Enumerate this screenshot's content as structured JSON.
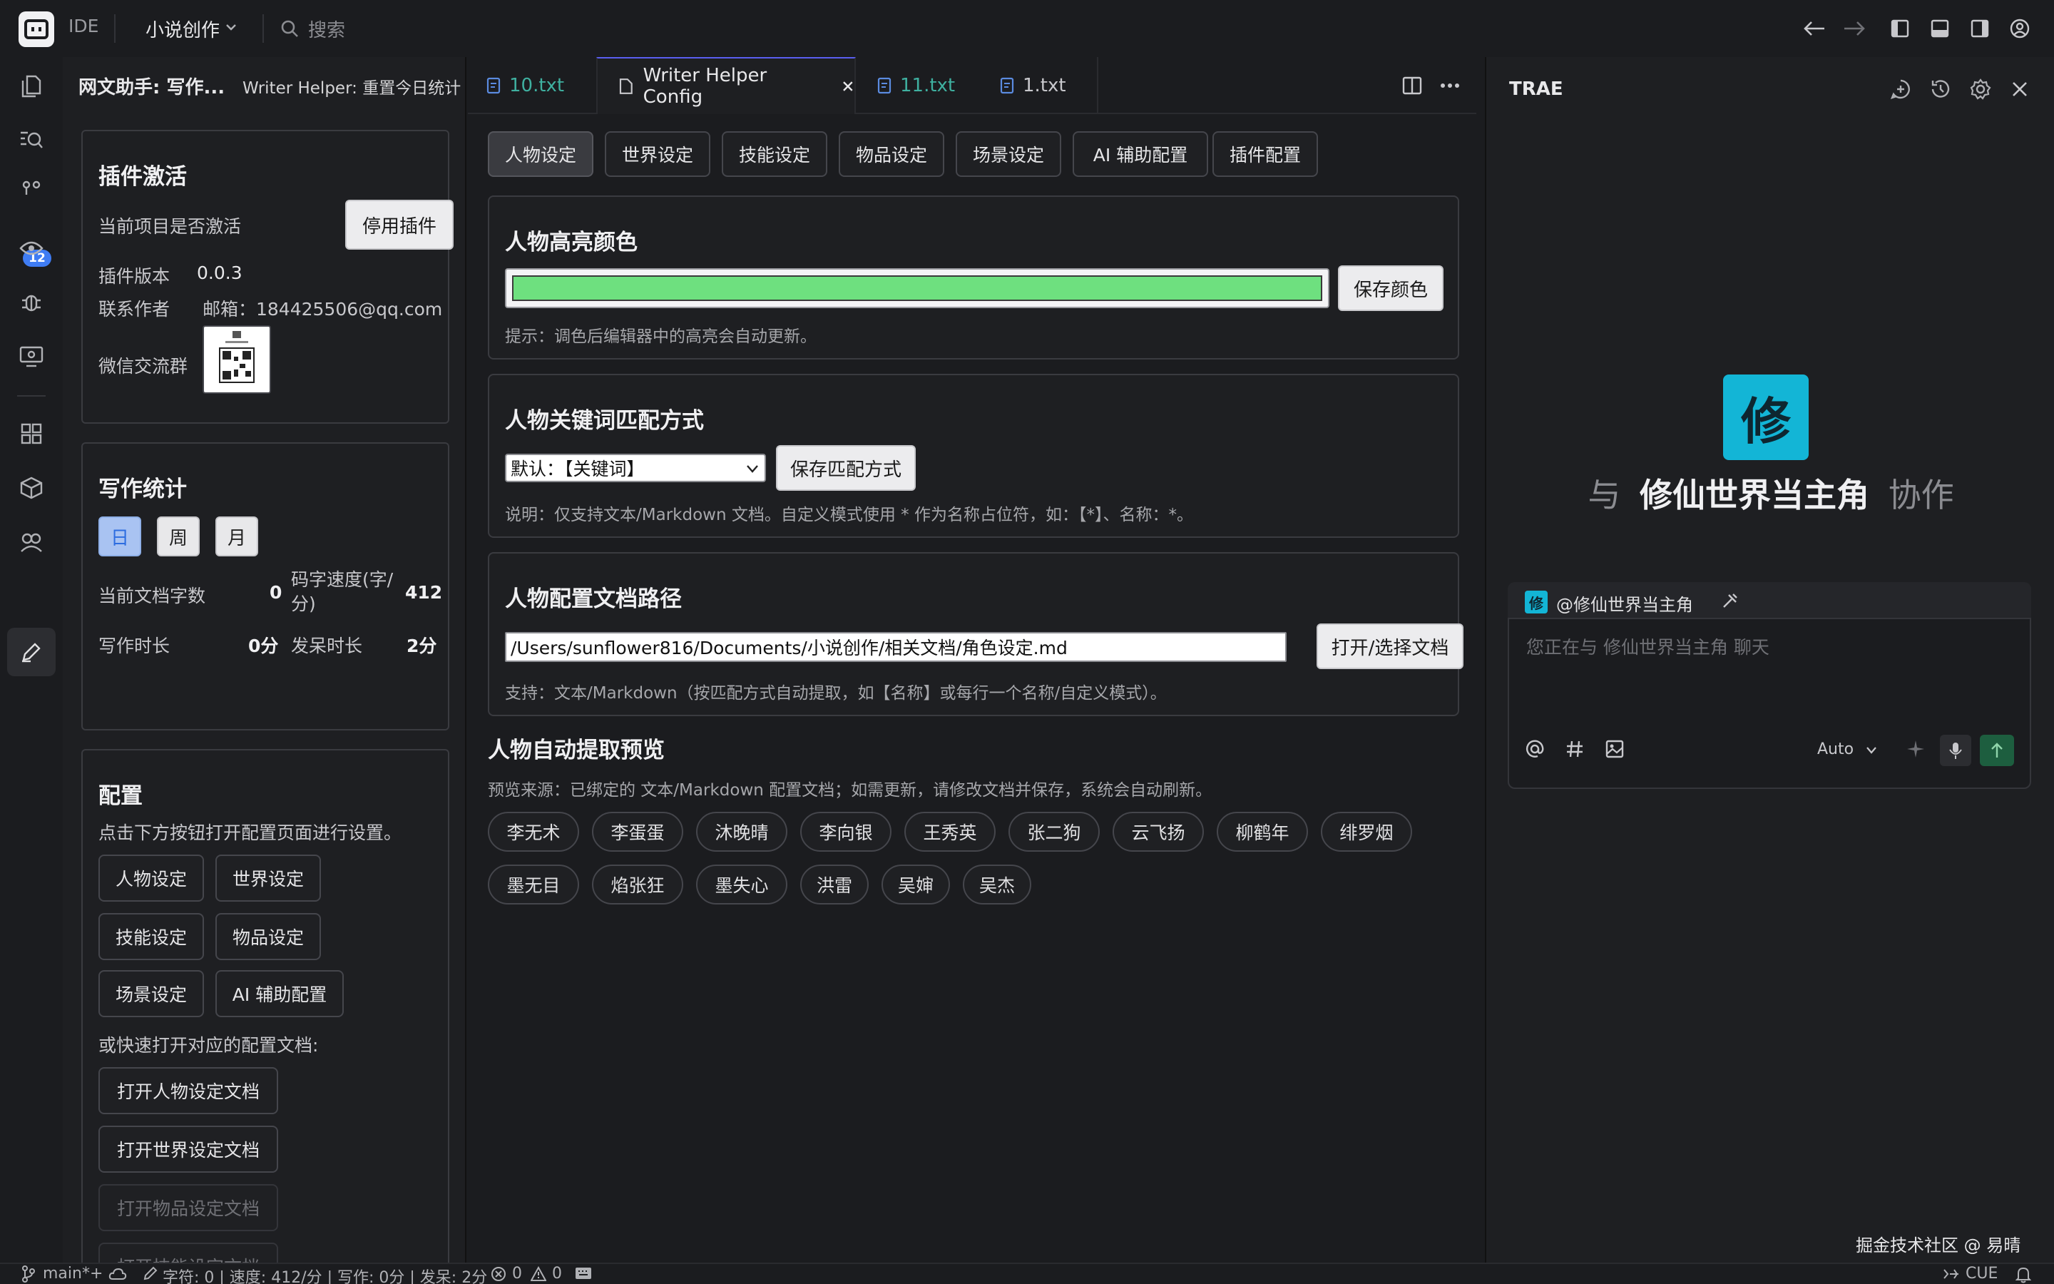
{
  "titlebar": {
    "ide_label": "IDE",
    "project": "小说创作",
    "search_placeholder": "搜索"
  },
  "activity": {
    "scm_badge": "12"
  },
  "left_panel": {
    "title": "网文助手: 写作...",
    "action": "Writer Helper: 重置今日统计",
    "activation": {
      "heading": "插件激活",
      "status_label": "当前项目是否激活",
      "disable_button": "停用插件",
      "version_label": "插件版本",
      "version_value": "0.0.3",
      "author_label": "联系作者",
      "author_value": "邮箱：184425506@qq.com",
      "wechat_label": "微信交流群"
    },
    "stats": {
      "heading": "写作统计",
      "periods": [
        "日",
        "周",
        "月"
      ],
      "chars_label": "当前文档字数",
      "chars_value": "0",
      "speed_label": "码字速度(字/分)",
      "speed_value": "412",
      "duration_label": "写作时长",
      "duration_value": "0分",
      "idle_label": "发呆时长",
      "idle_value": "2分"
    },
    "config": {
      "heading": "配置",
      "desc": "点击下方按钮打开配置页面进行设置。",
      "buttons": [
        "人物设定",
        "世界设定",
        "技能设定",
        "物品设定",
        "场景设定",
        "AI 辅助配置"
      ],
      "quick_label": "或快速打开对应的配置文档:",
      "open_buttons": [
        "打开人物设定文档",
        "打开世界设定文档",
        "打开物品设定文档",
        "打开技能设定文档"
      ]
    }
  },
  "editor": {
    "tabs": [
      {
        "label": "10.txt",
        "color": "#3fb0a0"
      },
      {
        "label": "Writer Helper Config",
        "color": "#e8e8ea"
      },
      {
        "label": "11.txt",
        "color": "#3fb0a0"
      },
      {
        "label": "1.txt",
        "color": "#c8c8cc"
      }
    ],
    "config_tabs": [
      "人物设定",
      "世界设定",
      "技能设定",
      "物品设定",
      "场景设定",
      "AI 辅助配置",
      "插件配置"
    ],
    "highlight": {
      "heading": "人物高亮颜色",
      "color": "#6ee07f",
      "save_button": "保存颜色",
      "hint": "提示：调色后编辑器中的高亮会自动更新。"
    },
    "match": {
      "heading": "人物关键词匹配方式",
      "selected": "默认：【关键词】",
      "save_button": "保存匹配方式",
      "hint": "说明：仅支持文本/Markdown 文档。自定义模式使用 * 作为名称占位符，如：【*】、名称：*。"
    },
    "path": {
      "heading": "人物配置文档路径",
      "value": "/Users/sunflower816/Documents/小说创作/相关文档/角色设定.md",
      "open_button": "打开/选择文档",
      "hint": "支持：文本/Markdown（按匹配方式自动提取，如【名称】或每行一个名称/自定义模式）。"
    },
    "preview": {
      "heading": "人物自动提取预览",
      "source": "预览来源：已绑定的 文本/Markdown 配置文档；如需更新，请修改文档并保存，系统会自动刷新。",
      "names_row1": [
        "李无术",
        "李蛋蛋",
        "沐晚晴",
        "李向银",
        "王秀英",
        "张二狗",
        "云飞扬",
        "柳鹤年",
        "绯罗烟"
      ],
      "names_row2": [
        "墨无目",
        "焰张狂",
        "墨失心",
        "洪雷",
        "吴婶",
        "吴杰"
      ]
    }
  },
  "right_panel": {
    "title": "TRAE",
    "agent_icon_char": "修",
    "heading_prefix": "与",
    "agent_name": "修仙世界当主角",
    "heading_suffix": "协作",
    "mention": "@修仙世界当主角",
    "input_placeholder": "您正在与 修仙世界当主角 聊天",
    "mode": "Auto"
  },
  "watermark": "掘金技术社区 @ 易晴",
  "statusbar": {
    "branch": "main*+",
    "stats": "字符: 0 | 速度: 412/分 | 写作: 0分 | 发呆: 2分",
    "errors": "0",
    "warnings": "0",
    "lang": "CUE"
  }
}
